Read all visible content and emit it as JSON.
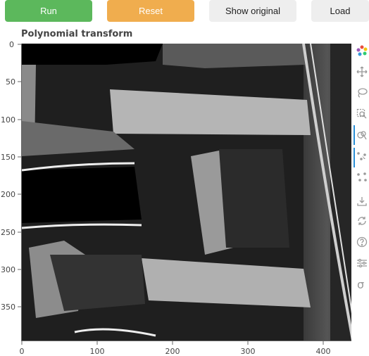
{
  "buttons": {
    "run": "Run",
    "reset": "Reset",
    "show_original": "Show original",
    "load": "Load"
  },
  "plot": {
    "title": "Polynomial transform",
    "x_ticks": [
      "0",
      "100",
      "200",
      "300",
      "400"
    ],
    "y_ticks": [
      "0",
      "50",
      "100",
      "150",
      "200",
      "250",
      "300",
      "350"
    ]
  },
  "toolbar": {
    "tools": [
      "bokeh-logo-icon",
      "pan-icon",
      "lasso-select-icon",
      "box-zoom-icon",
      "wheel-zoom-icon",
      "point-draw-icon",
      "poly-draw-icon",
      "save-icon",
      "reset-icon",
      "help-icon",
      "settings-icon",
      "sigma-icon"
    ]
  },
  "colors": {
    "run": "#5cb85c",
    "reset": "#f0ad4e",
    "neutral_button": "#eeeeee",
    "toolbar_active": "#2a8fd6"
  }
}
